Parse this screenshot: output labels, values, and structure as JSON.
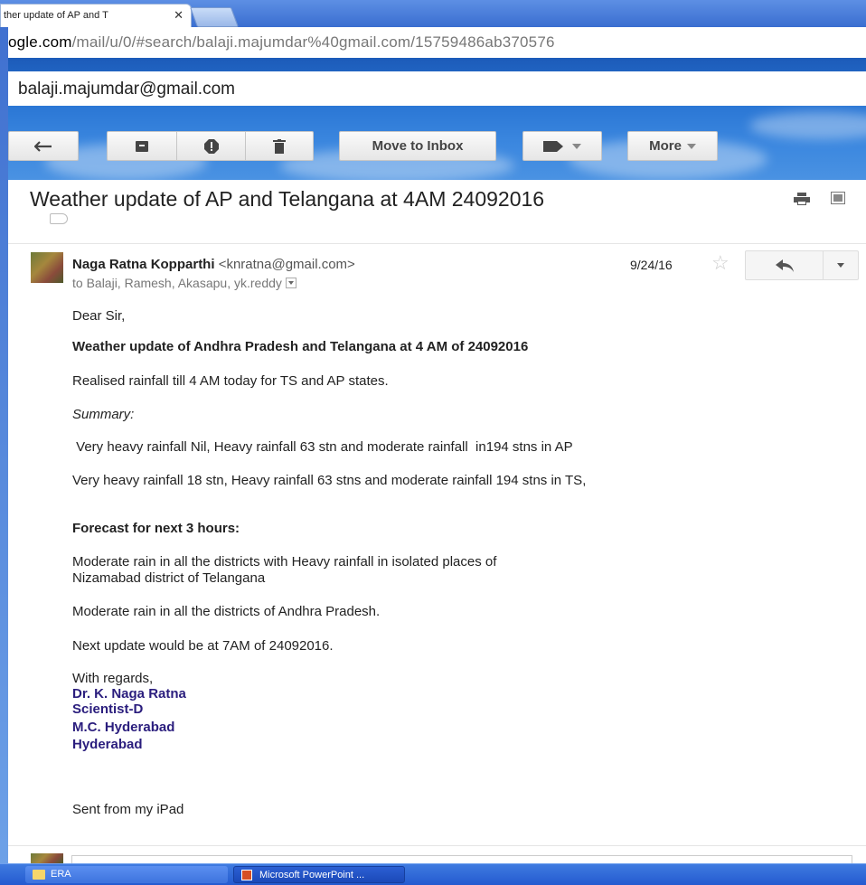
{
  "browser": {
    "tab_title": "ther update of AP and T",
    "tab_close": "✕",
    "url_host": "ogle.com",
    "url_path": "/mail/u/0/#search/balaji.majumdar%40gmail.com/15759486ab370576"
  },
  "gmail": {
    "account": "balaji.majumdar@gmail.com",
    "toolbar": {
      "move_to_inbox": "Move to Inbox",
      "more": "More"
    }
  },
  "email": {
    "subject": "Weather update of AP and Telangana at 4AM 24092016",
    "sender_name": "Naga Ratna Kopparthi",
    "sender_email": "<knratna@gmail.com>",
    "recipients": "to Balaji, Ramesh, Akasapu, yk.reddy",
    "date": "9/24/16",
    "body": {
      "greeting": "Dear Sir,",
      "heading": "Weather update of Andhra Pradesh  and Telangana at 4 AM of 24092016",
      "realised": "Realised rainfall till 4 AM today for TS and AP states.",
      "summary": "Summary:",
      "ap_line": " Very heavy rainfall Nil, Heavy rainfall 63 stn and moderate rainfall  in194 stns in AP",
      "ts_line": "Very heavy rainfall 18 stn, Heavy rainfall 63 stns and moderate rainfall 194 stns  in TS,",
      "forecast_heading": "Forecast for next 3 hours:",
      "forecast_line1": "Moderate rain in all the districts with Heavy rainfall  in isolated places of",
      "forecast_line2": "Nizamabad district of Telangana",
      "ap_forecast": "Moderate rain in all the districts of Andhra Pradesh.",
      "next_update": "Next update would be at 7AM of 24092016.",
      "regards": "With regards,",
      "sig_name": "Dr. K. Naga Ratna",
      "sig_title": "Scientist-D",
      "sig_org": "M.C. Hyderabad",
      "sig_city": "Hyderabad",
      "sent_from": "Sent from my iPad"
    }
  },
  "taskbar": {
    "item1": "ERA",
    "item2": "Microsoft PowerPoint ..."
  }
}
